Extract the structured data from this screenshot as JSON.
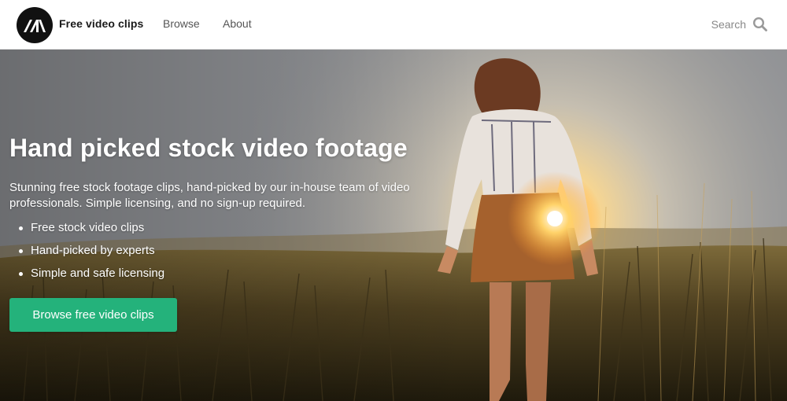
{
  "header": {
    "brand": "Free video clips",
    "nav": {
      "browse": "Browse",
      "about": "About"
    },
    "search": {
      "placeholder": "Search"
    }
  },
  "hero": {
    "title": "Hand picked stock video footage",
    "description": "Stunning free stock footage clips, hand-picked by our in-house team of video professionals. Simple licensing, and no sign-up required.",
    "bullets": [
      "Free stock video clips",
      "Hand-picked by experts",
      "Simple and safe licensing"
    ],
    "cta_label": "Browse free video clips"
  },
  "colors": {
    "accent": "#24b27b",
    "logo_bg": "#111111"
  },
  "icons": {
    "logo": "mixkit-logo-icon",
    "search": "search-icon"
  }
}
